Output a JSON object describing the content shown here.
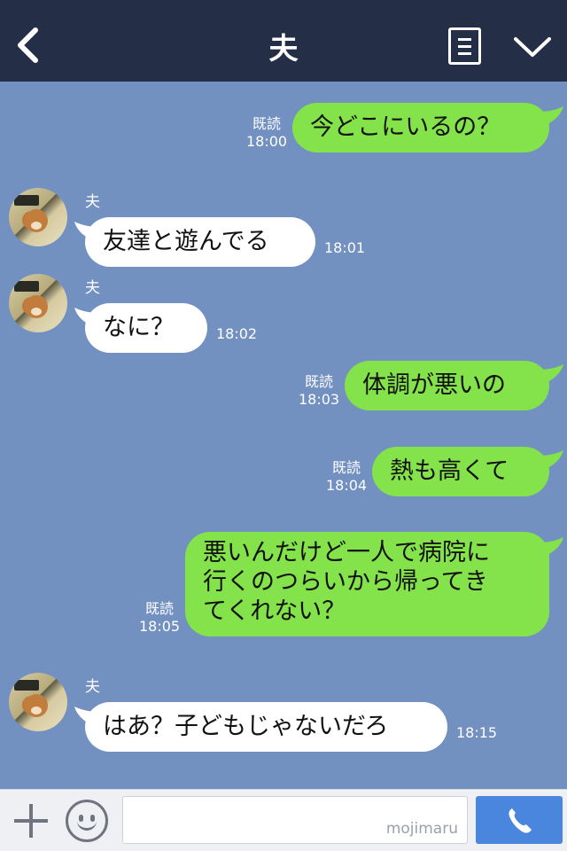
{
  "header": {
    "title": "夫"
  },
  "messages": [
    {
      "dir": "out",
      "text": "今どこにいるの？",
      "read": "既読",
      "time": "18:00"
    },
    {
      "dir": "in",
      "sender": "夫",
      "text": "友達と遊んでる",
      "time": "18:01"
    },
    {
      "dir": "in",
      "sender": "夫",
      "text": "なに？",
      "time": "18:02"
    },
    {
      "dir": "out",
      "text": "体調が悪いの",
      "read": "既読",
      "time": "18:03"
    },
    {
      "dir": "out",
      "text": "熱も高くて",
      "read": "既読",
      "time": "18:04"
    },
    {
      "dir": "out",
      "text_lines": [
        "悪いんだけど一人で病院に",
        "行くのつらいから帰ってき",
        "てくれない？"
      ],
      "read": "既読",
      "time": "18:05"
    },
    {
      "dir": "in",
      "sender": "夫",
      "text": "はあ？子どもじゃないだろ",
      "time": "18:15"
    }
  ],
  "footer": {
    "input_value": "",
    "watermark": "mojimaru"
  },
  "icons": {
    "back": "chevron-left-icon",
    "menu": "list-icon",
    "collapse": "chevron-down-icon",
    "add": "plus-icon",
    "sticker": "smiley-icon",
    "call": "phone-icon"
  },
  "colors": {
    "header_bg": "#252e47",
    "chat_bg": "#7290c0",
    "outgoing_bubble": "#84e24a",
    "incoming_bubble": "#ffffff",
    "send_button": "#4a86de"
  }
}
